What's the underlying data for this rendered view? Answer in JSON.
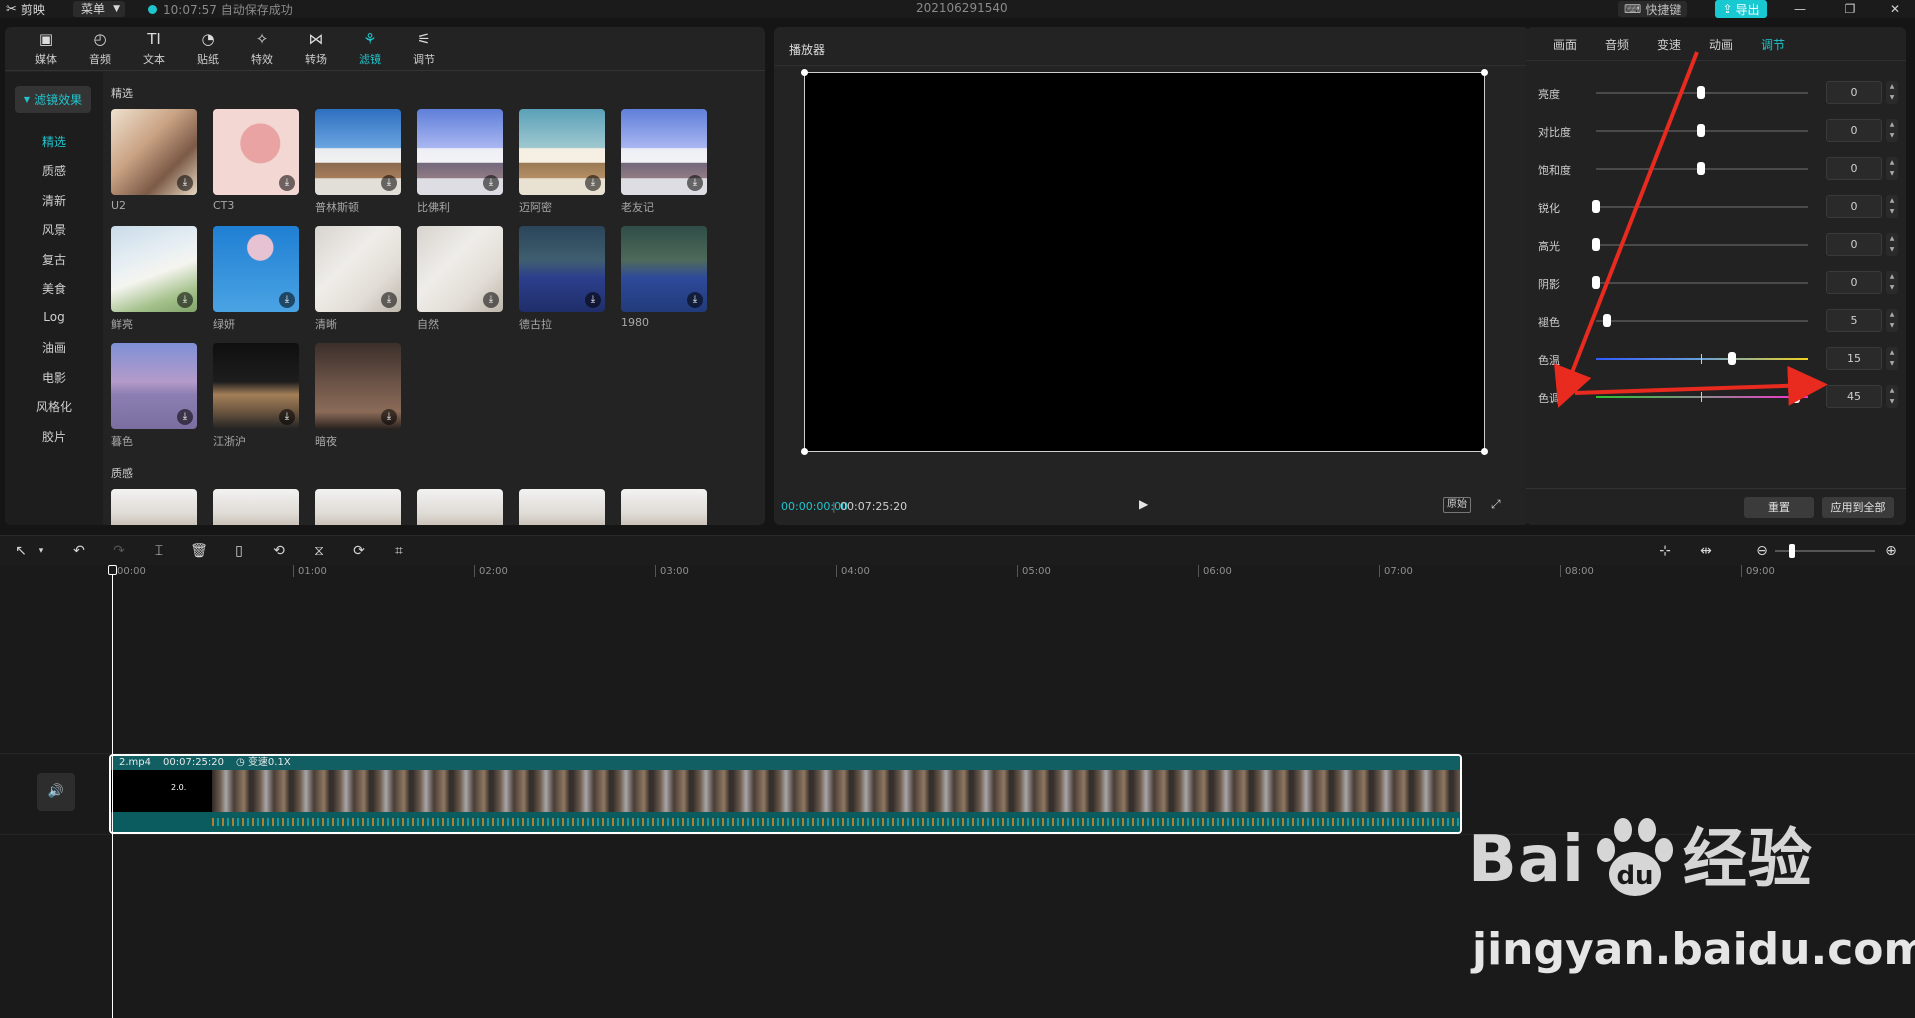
{
  "titlebar": {
    "app_name": "剪映",
    "menu_label": "菜单",
    "save_status": "10:07:57 自动保存成功",
    "project_name": "202106291540",
    "shortcut_label": "快捷键",
    "export_label": "导出"
  },
  "toolbar": {
    "tabs": [
      {
        "label": "媒体",
        "icon": "media-icon"
      },
      {
        "label": "音频",
        "icon": "audio-icon"
      },
      {
        "label": "文本",
        "icon": "text-icon"
      },
      {
        "label": "贴纸",
        "icon": "sticker-icon"
      },
      {
        "label": "特效",
        "icon": "effects-icon"
      },
      {
        "label": "转场",
        "icon": "transition-icon"
      },
      {
        "label": "滤镜",
        "icon": "filter-icon"
      },
      {
        "label": "调节",
        "icon": "adjust-icon"
      }
    ],
    "active": "滤镜"
  },
  "sidebar": {
    "header": "滤镜效果",
    "items": [
      "精选",
      "质感",
      "清新",
      "风景",
      "复古",
      "美食",
      "Log",
      "油画",
      "电影",
      "风格化",
      "胶片"
    ],
    "active": "精选"
  },
  "filters": {
    "section1_title": "精选",
    "section2_title": "质感",
    "items": [
      "U2",
      "CT3",
      "普林斯顿",
      "比佛利",
      "迈阿密",
      "老友记",
      "鲜亮",
      "绿妍",
      "清晰",
      "自然",
      "德古拉",
      "1980",
      "暮色",
      "江浙沪",
      "暗夜"
    ]
  },
  "player": {
    "title": "播放器",
    "current_time": "00:00:00:00",
    "duration": "00:07:25:20",
    "ratio_label": "原始"
  },
  "adjust": {
    "tabs": [
      "画面",
      "音频",
      "变速",
      "动画",
      "调节"
    ],
    "active_tab": "调节",
    "rows": [
      {
        "label": "亮度",
        "value": "0"
      },
      {
        "label": "对比度",
        "value": "0"
      },
      {
        "label": "饱和度",
        "value": "0"
      },
      {
        "label": "锐化",
        "value": "0"
      },
      {
        "label": "高光",
        "value": "0"
      },
      {
        "label": "阴影",
        "value": "0"
      },
      {
        "label": "褪色",
        "value": "5"
      },
      {
        "label": "色温",
        "value": "15"
      },
      {
        "label": "色调",
        "value": "45"
      }
    ],
    "reset_label": "重置",
    "apply_all_label": "应用到全部"
  },
  "timeline": {
    "ruler": [
      "00:00",
      "01:00",
      "02:00",
      "03:00",
      "04:00",
      "05:00",
      "06:00",
      "07:00",
      "08:00",
      "09:00"
    ],
    "clip": {
      "name": "2.mp4",
      "duration": "00:07:25:20",
      "speed": "变速0.1X",
      "first_frame_text": "2.0."
    }
  },
  "watermark": {
    "brand": "Bai",
    "brand_suffix": "经验",
    "url": "jingyan.baidu.com"
  },
  "colors": {
    "accent": "#20c4cc",
    "annotation_arrow": "#e82a1f"
  }
}
